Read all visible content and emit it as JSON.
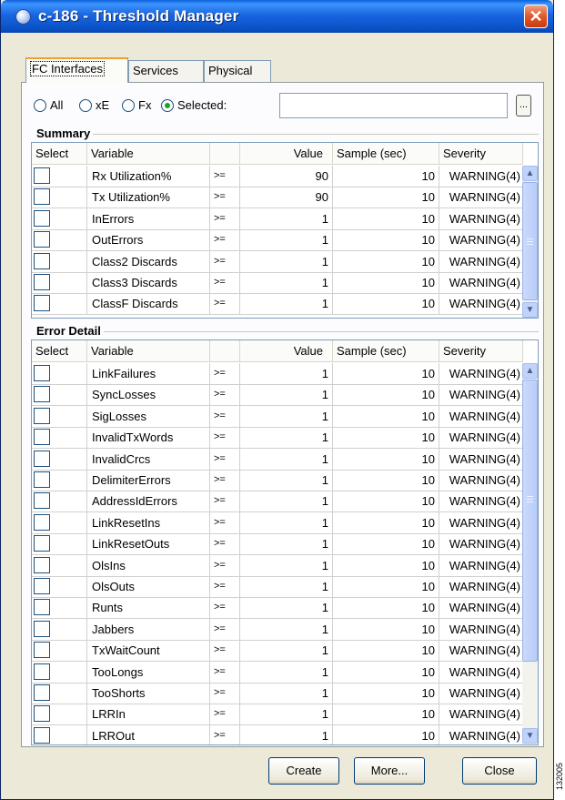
{
  "window": {
    "title": "c-186 - Threshold Manager"
  },
  "tabs": [
    {
      "label": "FC Interfaces",
      "active": true
    },
    {
      "label": "Services",
      "active": false
    },
    {
      "label": "Physical",
      "active": false
    }
  ],
  "filter": {
    "options": [
      {
        "label": "All",
        "checked": false
      },
      {
        "label": "xE",
        "checked": false
      },
      {
        "label": "Fx",
        "checked": false
      },
      {
        "label": "Selected:",
        "checked": true
      }
    ],
    "selected_value": "",
    "browse_label": "..."
  },
  "summary": {
    "title": "Summary",
    "columns": [
      "Select",
      "Variable",
      "",
      "Value",
      "Sample (sec)",
      "Severity"
    ],
    "rows": [
      {
        "variable": "Rx Utilization%",
        "op": ">=",
        "value": "90",
        "sample": "10",
        "severity": "WARNING(4)"
      },
      {
        "variable": "Tx Utilization%",
        "op": ">=",
        "value": "90",
        "sample": "10",
        "severity": "WARNING(4)"
      },
      {
        "variable": "InErrors",
        "op": ">=",
        "value": "1",
        "sample": "10",
        "severity": "WARNING(4)"
      },
      {
        "variable": "OutErrors",
        "op": ">=",
        "value": "1",
        "sample": "10",
        "severity": "WARNING(4)"
      },
      {
        "variable": "Class2 Discards",
        "op": ">=",
        "value": "1",
        "sample": "10",
        "severity": "WARNING(4)"
      },
      {
        "variable": "Class3 Discards",
        "op": ">=",
        "value": "1",
        "sample": "10",
        "severity": "WARNING(4)"
      },
      {
        "variable": "ClassF Discards",
        "op": ">=",
        "value": "1",
        "sample": "10",
        "severity": "WARNING(4)"
      }
    ]
  },
  "error_detail": {
    "title": "Error Detail",
    "columns": [
      "Select",
      "Variable",
      "",
      "Value",
      "Sample (sec)",
      "Severity"
    ],
    "rows": [
      {
        "variable": "LinkFailures",
        "op": ">=",
        "value": "1",
        "sample": "10",
        "severity": "WARNING(4)"
      },
      {
        "variable": "SyncLosses",
        "op": ">=",
        "value": "1",
        "sample": "10",
        "severity": "WARNING(4)"
      },
      {
        "variable": "SigLosses",
        "op": ">=",
        "value": "1",
        "sample": "10",
        "severity": "WARNING(4)"
      },
      {
        "variable": "InvalidTxWords",
        "op": ">=",
        "value": "1",
        "sample": "10",
        "severity": "WARNING(4)"
      },
      {
        "variable": "InvalidCrcs",
        "op": ">=",
        "value": "1",
        "sample": "10",
        "severity": "WARNING(4)"
      },
      {
        "variable": "DelimiterErrors",
        "op": ">=",
        "value": "1",
        "sample": "10",
        "severity": "WARNING(4)"
      },
      {
        "variable": "AddressIdErrors",
        "op": ">=",
        "value": "1",
        "sample": "10",
        "severity": "WARNING(4)"
      },
      {
        "variable": "LinkResetIns",
        "op": ">=",
        "value": "1",
        "sample": "10",
        "severity": "WARNING(4)"
      },
      {
        "variable": "LinkResetOuts",
        "op": ">=",
        "value": "1",
        "sample": "10",
        "severity": "WARNING(4)"
      },
      {
        "variable": "OlsIns",
        "op": ">=",
        "value": "1",
        "sample": "10",
        "severity": "WARNING(4)"
      },
      {
        "variable": "OlsOuts",
        "op": ">=",
        "value": "1",
        "sample": "10",
        "severity": "WARNING(4)"
      },
      {
        "variable": "Runts",
        "op": ">=",
        "value": "1",
        "sample": "10",
        "severity": "WARNING(4)"
      },
      {
        "variable": "Jabbers",
        "op": ">=",
        "value": "1",
        "sample": "10",
        "severity": "WARNING(4)"
      },
      {
        "variable": "TxWaitCount",
        "op": ">=",
        "value": "1",
        "sample": "10",
        "severity": "WARNING(4)"
      },
      {
        "variable": "TooLongs",
        "op": ">=",
        "value": "1",
        "sample": "10",
        "severity": "WARNING(4)"
      },
      {
        "variable": "TooShorts",
        "op": ">=",
        "value": "1",
        "sample": "10",
        "severity": "WARNING(4)"
      },
      {
        "variable": "LRRIn",
        "op": ">=",
        "value": "1",
        "sample": "10",
        "severity": "WARNING(4)"
      },
      {
        "variable": "LRROut",
        "op": ">=",
        "value": "1",
        "sample": "10",
        "severity": "WARNING(4)"
      }
    ]
  },
  "buttons": {
    "create": "Create",
    "more": "More...",
    "close": "Close"
  },
  "figure_id": "132005",
  "icons": {
    "app": "app-globe-icon",
    "close": "close-icon"
  },
  "colors": {
    "title_bar": "#1a66e0",
    "close_button": "#e0582a",
    "active_tab_accent": "#f0a030",
    "radio_checked": "#21a121"
  }
}
